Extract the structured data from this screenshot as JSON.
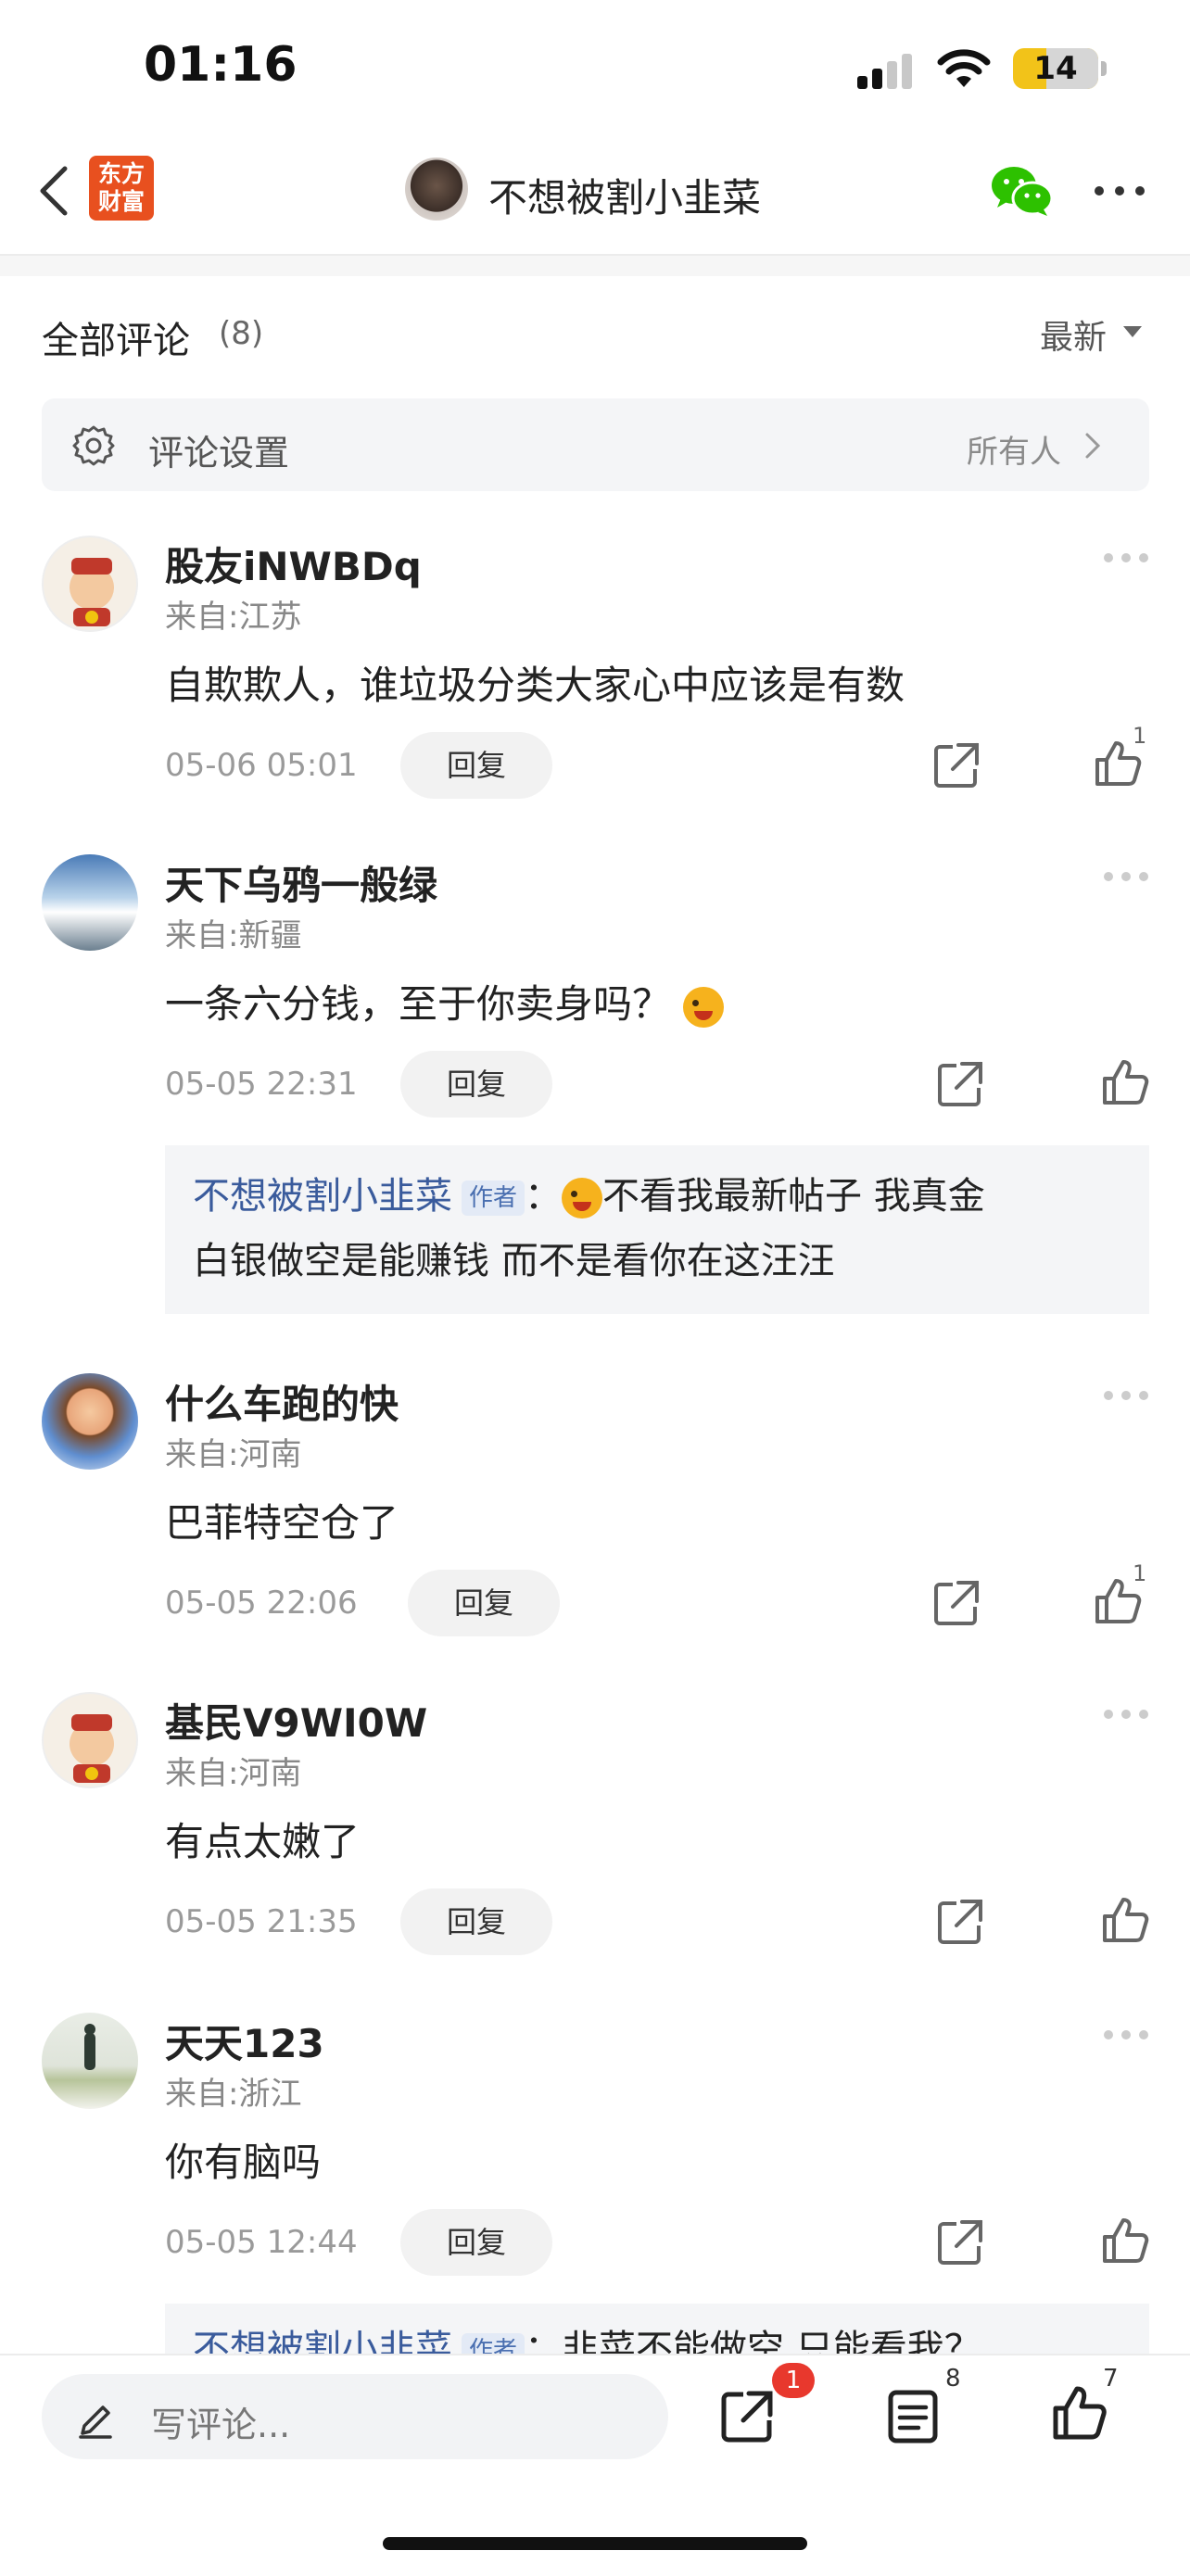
{
  "status_bar": {
    "time": "01:16",
    "battery": "14"
  },
  "header": {
    "logo_text": "东方\n财富",
    "author_name": "不想被割小韭菜"
  },
  "comments_header": {
    "title": "全部评论",
    "count": "(8)",
    "sort_label": "最新"
  },
  "settings_row": {
    "label": "评论设置",
    "value": "所有人"
  },
  "comments": [
    {
      "name": "股友iNWBDq",
      "location": "来自:江苏",
      "text": "自欺欺人，谁垃圾分类大家心中应该是有数",
      "time": "05-06 05:01",
      "reply_label": "回复",
      "likes": "1"
    },
    {
      "name": "天下乌鸦一般绿",
      "location": "来自:新疆",
      "text": "一条六分钱，至于你卖身吗？",
      "time": "05-05 22:31",
      "reply_label": "回复",
      "likes": "",
      "sub_reply": {
        "author": "不想被割小韭菜",
        "badge": "作者",
        "sep": "：",
        "line1": "不看我最新帖子 我真金",
        "line2": "白银做空是能赚钱 而不是看你在这汪汪"
      }
    },
    {
      "name": "什么车跑的快",
      "location": "来自:河南",
      "text": "巴菲特空仓了",
      "time": "05-05 22:06",
      "reply_label": "回复",
      "likes": "1"
    },
    {
      "name": "基民V9WI0W",
      "location": "来自:河南",
      "text": "有点太嫩了",
      "time": "05-05 21:35",
      "reply_label": "回复",
      "likes": ""
    },
    {
      "name": "天天123",
      "location": "来自:浙江",
      "text": "你有脑吗",
      "time": "05-05 12:44",
      "reply_label": "回复",
      "likes": "",
      "sub_reply": {
        "author": "不想被割小韭菜",
        "badge": "作者",
        "sep": "：",
        "line1": "韭菜不能做空 只能看我？",
        "line2": ""
      }
    }
  ],
  "bottom_bar": {
    "placeholder": "写评论...",
    "share_badge": "1",
    "comment_count": "8",
    "like_count": "7"
  },
  "colors": {
    "accent_orange": "#e8501f",
    "author_blue": "#3a5b9c",
    "badge_red": "#e8382d",
    "wechat_green": "#2dc100"
  }
}
